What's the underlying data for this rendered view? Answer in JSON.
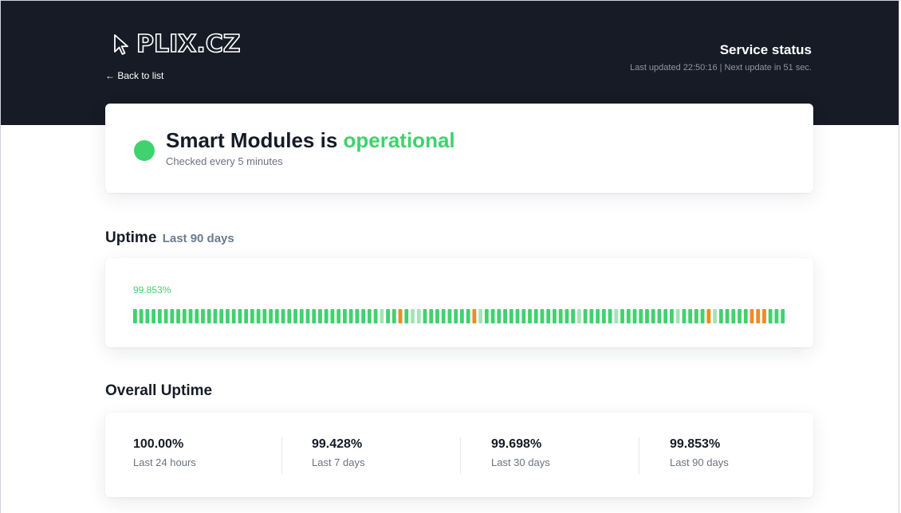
{
  "header": {
    "logo_text": "PLIX.CZ",
    "back_label": "← Back to list",
    "status_title": "Service status",
    "last_updated": "Last updated 22:50:16 | Next update in 51 sec."
  },
  "service": {
    "name_prefix": "Smart Modules is ",
    "state": "operational",
    "check_interval": "Checked every 5 minutes"
  },
  "uptime_section": {
    "title": "Uptime",
    "subtitle": "Last 90 days",
    "percent": "99.853%",
    "bars": [
      "g",
      "g",
      "g",
      "g",
      "g",
      "g",
      "g",
      "g",
      "g",
      "g",
      "g",
      "g",
      "g",
      "g",
      "g",
      "g",
      "g",
      "g",
      "g",
      "g",
      "g",
      "g",
      "g",
      "g",
      "g",
      "g",
      "g",
      "g",
      "g",
      "g",
      "g",
      "g",
      "g",
      "g",
      "g",
      "g",
      "g",
      "g",
      "g",
      "g",
      "l",
      "g",
      "g",
      "o",
      "g",
      "l",
      "l",
      "g",
      "g",
      "g",
      "g",
      "g",
      "g",
      "g",
      "g",
      "o",
      "l",
      "g",
      "g",
      "g",
      "g",
      "g",
      "g",
      "g",
      "g",
      "g",
      "g",
      "g",
      "g",
      "g",
      "g",
      "g",
      "l",
      "g",
      "g",
      "g",
      "g",
      "g",
      "l",
      "g",
      "g",
      "g",
      "g",
      "g",
      "g",
      "g",
      "g",
      "g",
      "l",
      "g",
      "g",
      "g",
      "g",
      "o",
      "l",
      "g",
      "g",
      "g",
      "g",
      "g",
      "o",
      "o",
      "o",
      "g",
      "g",
      "g"
    ]
  },
  "overall_section": {
    "title": "Overall Uptime",
    "stats": [
      {
        "value": "100.00%",
        "label": "Last 24 hours"
      },
      {
        "value": "99.428%",
        "label": "Last 7 days"
      },
      {
        "value": "99.698%",
        "label": "Last 30 days"
      },
      {
        "value": "99.853%",
        "label": "Last 90 days"
      }
    ]
  },
  "colors": {
    "header_bg": "#161b26",
    "operational": "#3fd26e",
    "bar_green": "#3fd26e",
    "bar_light": "#a5e3b8",
    "bar_orange": "#f08a24"
  },
  "icons": {
    "logo": "cursor-arrow-icon",
    "back": "arrow-left-icon"
  }
}
